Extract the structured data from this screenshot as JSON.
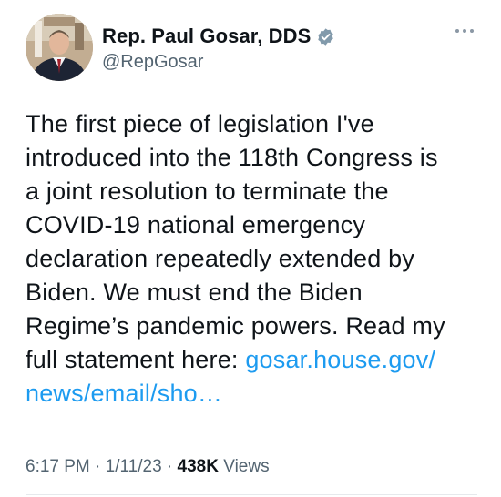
{
  "author": {
    "display_name": "Rep. Paul Gosar, DDS",
    "handle": "@RepGosar",
    "verified": true
  },
  "tweet": {
    "lines": [
      "The first piece of legislation I've",
      "introduced into the 118th Congress is",
      "a joint resolution to terminate the",
      "COVID-19 national emergency",
      "declaration repeatedly extended by",
      "Biden. We must end the Biden",
      "Regime’s pandemic powers. Read my",
      "full statement here: "
    ],
    "link_part1": "gosar.house.gov/",
    "link_part2": "news/email/sho…"
  },
  "meta": {
    "time": "6:17 PM",
    "separator1": "·",
    "date": "1/11/23",
    "separator2": "·",
    "views_count": "438K",
    "views_label": "Views"
  },
  "colors": {
    "text": "#0f1419",
    "secondary": "#536471",
    "link": "#1d9bf0",
    "verified_badge": "#829aab"
  },
  "icons": {
    "verified": "verified-badge-icon",
    "more": "more-dots-icon"
  }
}
